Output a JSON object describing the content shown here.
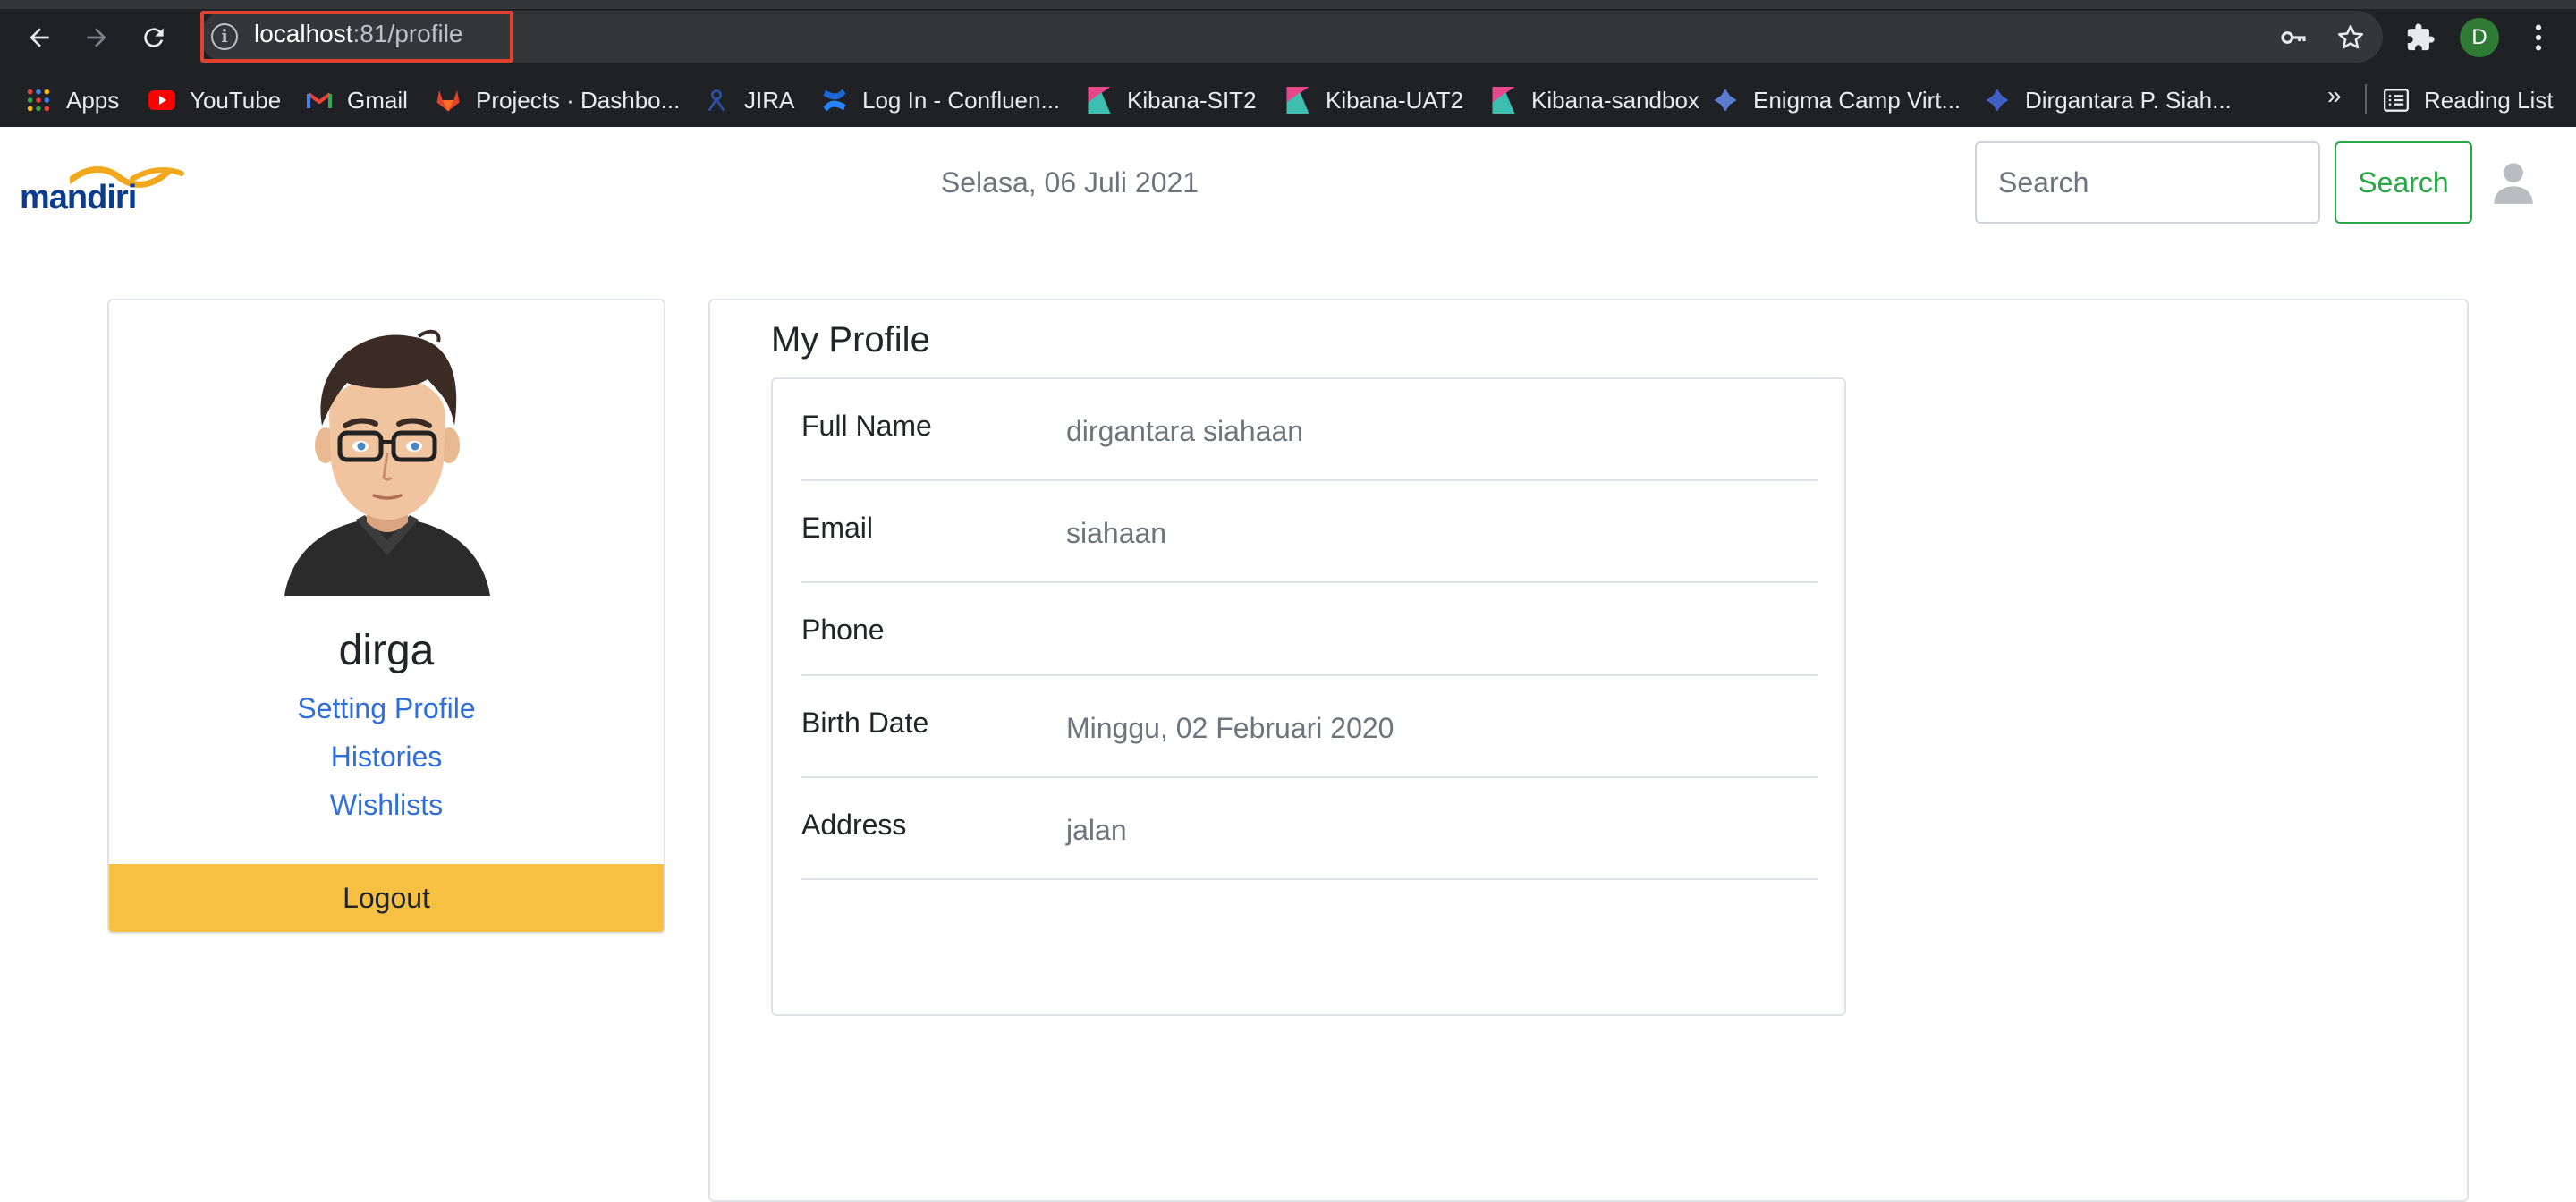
{
  "browser": {
    "url_host": "localhost",
    "url_path": ":81/profile",
    "profile_initial": "D",
    "bookmarks_more": "»",
    "bookmarks": [
      {
        "label": "Apps",
        "icon": "apps-grid-icon"
      },
      {
        "label": "YouTube",
        "icon": "youtube-icon"
      },
      {
        "label": "Gmail",
        "icon": "gmail-icon"
      },
      {
        "label": "Projects · Dashbo...",
        "icon": "gitlab-icon"
      },
      {
        "label": "JIRA",
        "icon": "jira-icon"
      },
      {
        "label": "Log In - Confluen...",
        "icon": "confluence-icon"
      },
      {
        "label": "Kibana-SIT2",
        "icon": "kibana-icon"
      },
      {
        "label": "Kibana-UAT2",
        "icon": "kibana-icon"
      },
      {
        "label": "Kibana-sandbox",
        "icon": "kibana-icon"
      },
      {
        "label": "Enigma Camp Virt...",
        "icon": "enigma-icon"
      },
      {
        "label": "Dirgantara P. Siah...",
        "icon": "enigma-icon"
      }
    ],
    "reading_list": "Reading List"
  },
  "navbar": {
    "brand": "mandiri",
    "date": "Selasa, 06 Juli 2021",
    "search_placeholder": "Search",
    "search_button": "Search"
  },
  "sidebar": {
    "username": "dirga",
    "links": [
      "Setting Profile",
      "Histories",
      "Wishlists"
    ],
    "logout": "Logout"
  },
  "profile": {
    "title": "My Profile",
    "fields": [
      {
        "label": "Full Name",
        "value": "dirgantara siahaan"
      },
      {
        "label": "Email",
        "value": "siahaan"
      },
      {
        "label": "Phone",
        "value": ""
      },
      {
        "label": "Birth Date",
        "value": "Minggu, 02 Februari 2020"
      },
      {
        "label": "Address",
        "value": "jalan"
      }
    ]
  },
  "colors": {
    "chrome_bg": "#202124",
    "accent_green": "#28a745",
    "link_blue": "#2f6fdc",
    "logout_yellow": "#f6c042",
    "url_highlight": "#e2402f"
  }
}
